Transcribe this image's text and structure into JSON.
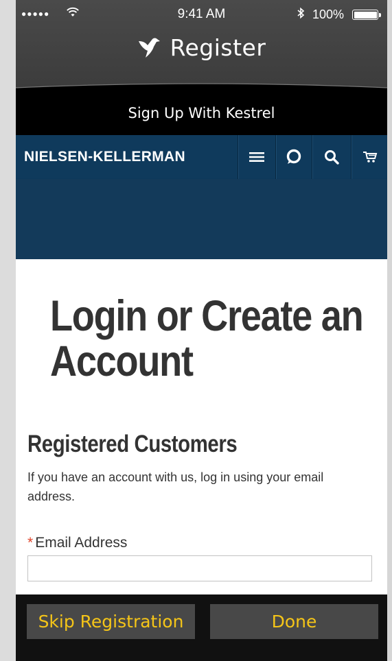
{
  "status_bar": {
    "signal": "●●●●●",
    "time": "9:41 AM",
    "battery": "100%"
  },
  "header": {
    "title": "Register",
    "icon": "bird-icon"
  },
  "signup_bar": {
    "text": "Sign Up With Kestrel"
  },
  "site_nav": {
    "brand": "NIELSEN-KELLERMAN",
    "icons": [
      "menu-icon",
      "chat-icon",
      "search-icon",
      "cart-icon"
    ]
  },
  "content": {
    "page_title": "Login or Create an Account",
    "section_title": "Registered Customers",
    "section_desc": "If you have an account with us, log in using your email address.",
    "email_label": "Email Address",
    "required_marker": "*",
    "email_value": ""
  },
  "bottom_bar": {
    "skip_label": "Skip Registration",
    "done_label": "Done"
  },
  "colors": {
    "nav_blue": "#0f3a5c",
    "accent_yellow": "#f5c518",
    "required_red": "#e0442a"
  }
}
